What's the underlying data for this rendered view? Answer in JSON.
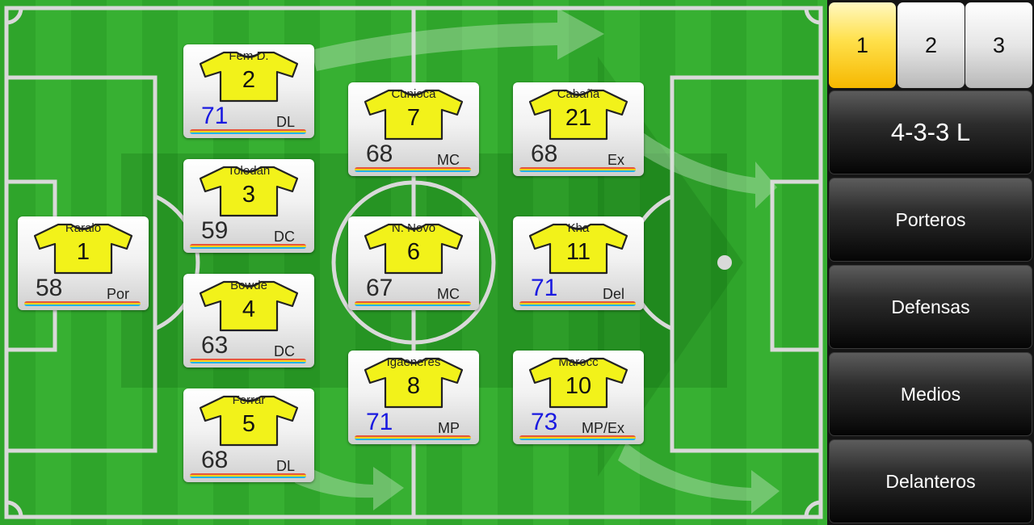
{
  "tabs": [
    {
      "label": "1",
      "active": true
    },
    {
      "label": "2",
      "active": false
    },
    {
      "label": "3",
      "active": false
    }
  ],
  "formation": "4-3-3 L",
  "menu": {
    "porteros": "Porteros",
    "defensas": "Defensas",
    "medios": "Medios",
    "delanteros": "Delanteros"
  },
  "players": [
    {
      "name": "Raralo",
      "number": "1",
      "rating": "58",
      "position": "Por",
      "highlight": false
    },
    {
      "name": "Fem D.",
      "number": "2",
      "rating": "71",
      "position": "DL",
      "highlight": true
    },
    {
      "name": "Toledan",
      "number": "3",
      "rating": "59",
      "position": "DC",
      "highlight": false
    },
    {
      "name": "Bowde",
      "number": "4",
      "rating": "63",
      "position": "DC",
      "highlight": false
    },
    {
      "name": "Ferrar",
      "number": "5",
      "rating": "68",
      "position": "DL",
      "highlight": false
    },
    {
      "name": "Cunioca",
      "number": "7",
      "rating": "68",
      "position": "MC",
      "highlight": false
    },
    {
      "name": "N. Novo",
      "number": "6",
      "rating": "67",
      "position": "MC",
      "highlight": false
    },
    {
      "name": "Igaeneres",
      "number": "8",
      "rating": "71",
      "position": "MP",
      "highlight": true
    },
    {
      "name": "Cabaña",
      "number": "21",
      "rating": "68",
      "position": "Ex",
      "highlight": false
    },
    {
      "name": "Kha",
      "number": "11",
      "rating": "71",
      "position": "Del",
      "highlight": true
    },
    {
      "name": "Marocc",
      "number": "10",
      "rating": "73",
      "position": "MP/Ex",
      "highlight": true
    }
  ],
  "colors": {
    "pitch_light": "#37b032",
    "pitch_dark": "#2fa52b",
    "shirt": "#f2f21a",
    "rating_highlight": "#1a1ae0",
    "tab_active": "#ffe04a"
  }
}
